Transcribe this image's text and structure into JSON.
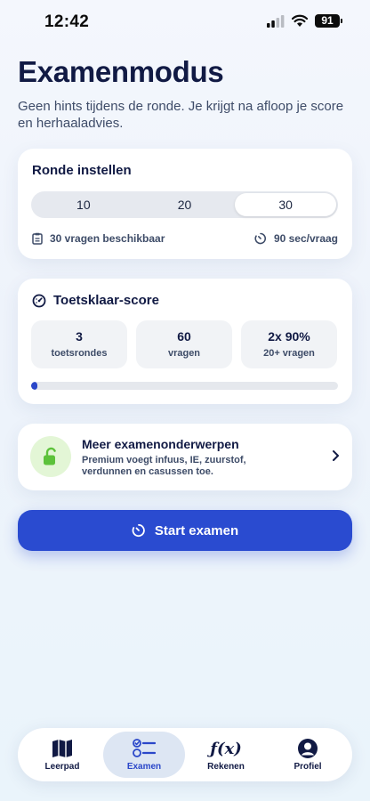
{
  "status": {
    "time": "12:42",
    "battery": "91"
  },
  "header": {
    "title": "Examenmodus",
    "subtitle": "Geen hints tijdens de ronde. Je krijgt na afloop je score en herhaaladvies."
  },
  "round": {
    "title": "Ronde instellen",
    "options": [
      "10",
      "20",
      "30"
    ],
    "selected": "30",
    "available": "30 vragen beschikbaar",
    "time_per_question": "90 sec/vraag"
  },
  "score": {
    "title": "Toetsklaar-score",
    "stats": [
      {
        "value": "3",
        "label": "toetsrondes"
      },
      {
        "value": "60",
        "label": "vragen"
      },
      {
        "value": "2x 90%",
        "label": "20+ vragen"
      }
    ],
    "progress_fraction": 0.02
  },
  "premium": {
    "title": "Meer examenonderwerpen",
    "description": "Premium voegt infuus, IE, zuurstof, verdunnen en casussen toe."
  },
  "start_button": {
    "label": "Start examen"
  },
  "tabs": [
    {
      "label": "Leerpad",
      "icon": "map-icon"
    },
    {
      "label": "Examen",
      "icon": "checklist-icon",
      "active": true
    },
    {
      "label": "Rekenen",
      "icon": "function-icon"
    },
    {
      "label": "Profiel",
      "icon": "profile-icon"
    }
  ],
  "colors": {
    "accent": "#2a4bd0",
    "title": "#111a44",
    "lock_bg": "#e3f6d6",
    "lock": "#5cc23a"
  }
}
